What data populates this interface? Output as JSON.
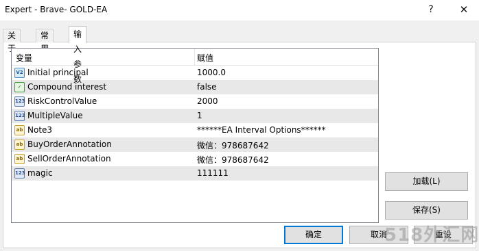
{
  "window": {
    "title": "Expert - Brave- GOLD-EA",
    "help_label": "?",
    "close_label": "✕"
  },
  "tabs": [
    {
      "label": "关于"
    },
    {
      "label": "常用"
    },
    {
      "label": "输入参数",
      "active": true
    }
  ],
  "grid": {
    "headers": {
      "variable": "变量",
      "value": "赋值"
    },
    "rows": [
      {
        "icon": "double-type-icon",
        "badge": "V2",
        "name": "Initial principal",
        "value": "1000.0"
      },
      {
        "icon": "bool-type-icon",
        "badge": "✓",
        "name": "Compound interest",
        "value": "false"
      },
      {
        "icon": "int-type-icon",
        "badge": "123",
        "name": "RiskControlValue",
        "value": "2000"
      },
      {
        "icon": "int-type-icon",
        "badge": "123",
        "name": "MultipleValue",
        "value": "1"
      },
      {
        "icon": "string-type-icon",
        "badge": "ab",
        "name": "Note3",
        "value": "******EA Interval Options******"
      },
      {
        "icon": "string-type-icon",
        "badge": "ab",
        "name": "BuyOrderAnnotation",
        "value": "微信：978687642"
      },
      {
        "icon": "string-type-icon",
        "badge": "ab",
        "name": "SellOrderAnnotation",
        "value": "微信：978687642"
      },
      {
        "icon": "int-type-icon",
        "badge": "123",
        "name": "magic",
        "value": "111111"
      }
    ]
  },
  "side_buttons": {
    "load": "加载(L)",
    "save": "保存(S)"
  },
  "footer": {
    "ok": "确定",
    "cancel": "取消",
    "reset": "重设"
  },
  "watermark": "518外汇网"
}
